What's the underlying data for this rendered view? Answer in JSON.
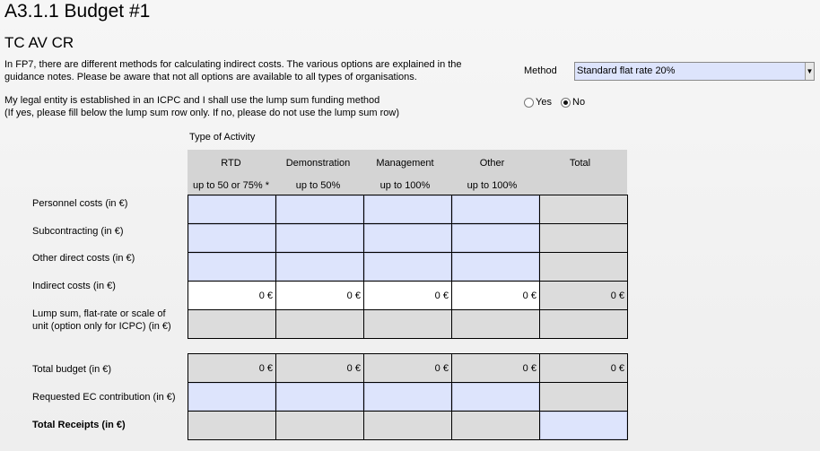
{
  "title": "A3.1.1 Budget #1",
  "subtitle": "TC AV CR",
  "intro_line1": "In FP7, there are different methods for calculating indirect costs. The various options are explained in the",
  "intro_line2": "guidance notes. Please be aware that not all options are available to all types of organisations.",
  "method": {
    "label": "Method",
    "value": "Standard flat rate 20%"
  },
  "icpc_line1": "My legal entity is established in an ICPC and I shall use the lump sum funding method",
  "icpc_line2": "(If yes, please fill below the lump sum row only. If no, please do not use the lump sum row)",
  "radio": {
    "yes": "Yes",
    "no": "No",
    "selected": "No"
  },
  "type_of_activity": "Type of Activity",
  "columns": [
    {
      "name": "RTD",
      "sub": "up to 50 or 75% *"
    },
    {
      "name": "Demonstration",
      "sub": "up to 50%"
    },
    {
      "name": "Management",
      "sub": "up to 100%"
    },
    {
      "name": "Other",
      "sub": "up to 100%"
    },
    {
      "name": "Total",
      "sub": ""
    }
  ],
  "rows": {
    "personnel": "Personnel costs (in €)",
    "subcontracting": "Subcontracting (in €)",
    "other_direct": "Other direct costs (in €)",
    "indirect": "Indirect costs (in €)",
    "lump_line1": "Lump sum, flat-rate or scale of",
    "lump_line2": "unit (option only for ICPC) (in €)",
    "total_budget": "Total budget (in €)",
    "requested": "Requested EC contribution (in €)",
    "receipts": "Total Receipts (in €)"
  },
  "indirect_values": [
    "0 €",
    "0 €",
    "0 €",
    "0 €",
    "0 €"
  ],
  "total_budget_values": [
    "0 €",
    "0 €",
    "0 €",
    "0 €",
    "0 €"
  ],
  "colors": {
    "input_fill": "#dde4fc",
    "readonly_fill": "#dcdcdc",
    "header_fill": "#d4d4d4"
  }
}
